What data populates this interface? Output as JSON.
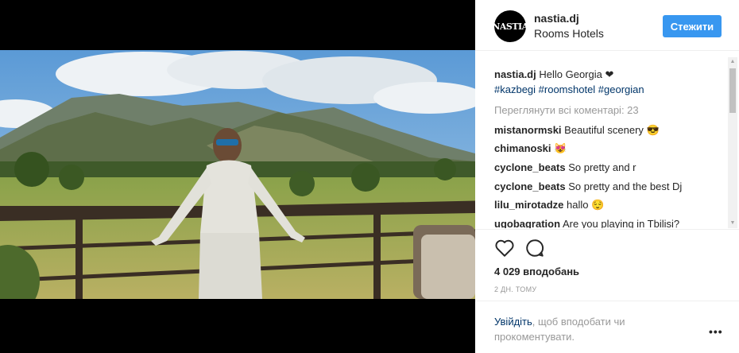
{
  "post": {
    "username": "nastia.dj",
    "location": "Rooms Hotels",
    "avatar_text": "NASTIA",
    "follow_label": "Стежити"
  },
  "caption": {
    "username": "nastia.dj",
    "text": "Hello Georgia ❤",
    "hashtags": "#kazbegi #roomshotel #georgian"
  },
  "view_all_comments": "Переглянути всі коментарі: 23",
  "comments": [
    {
      "username": "mistanormski",
      "text": "Beautiful scenery 😎"
    },
    {
      "username": "chimanoski",
      "text": "😻"
    },
    {
      "username": "cyclone_beats",
      "text": "So pretty and r"
    },
    {
      "username": "cyclone_beats",
      "text": "So pretty and the best Dj"
    },
    {
      "username": "lilu_mirotadze",
      "text": "hallo 😌"
    },
    {
      "username": "ugobagration",
      "text": "Are you playing in Tbilisi?"
    }
  ],
  "likes": "4 029 вподобань",
  "timestamp": "2 ДН. ТОМУ",
  "login_prompt": {
    "link": "Увійдіть",
    "text": ", щоб вподобати чи прокоментувати."
  },
  "icons": {
    "like": "heart-outline-icon",
    "comment": "speech-bubble-icon",
    "more": "more-options-icon"
  },
  "colors": {
    "accent": "#3897f0",
    "link": "#003569",
    "muted": "#999999"
  }
}
